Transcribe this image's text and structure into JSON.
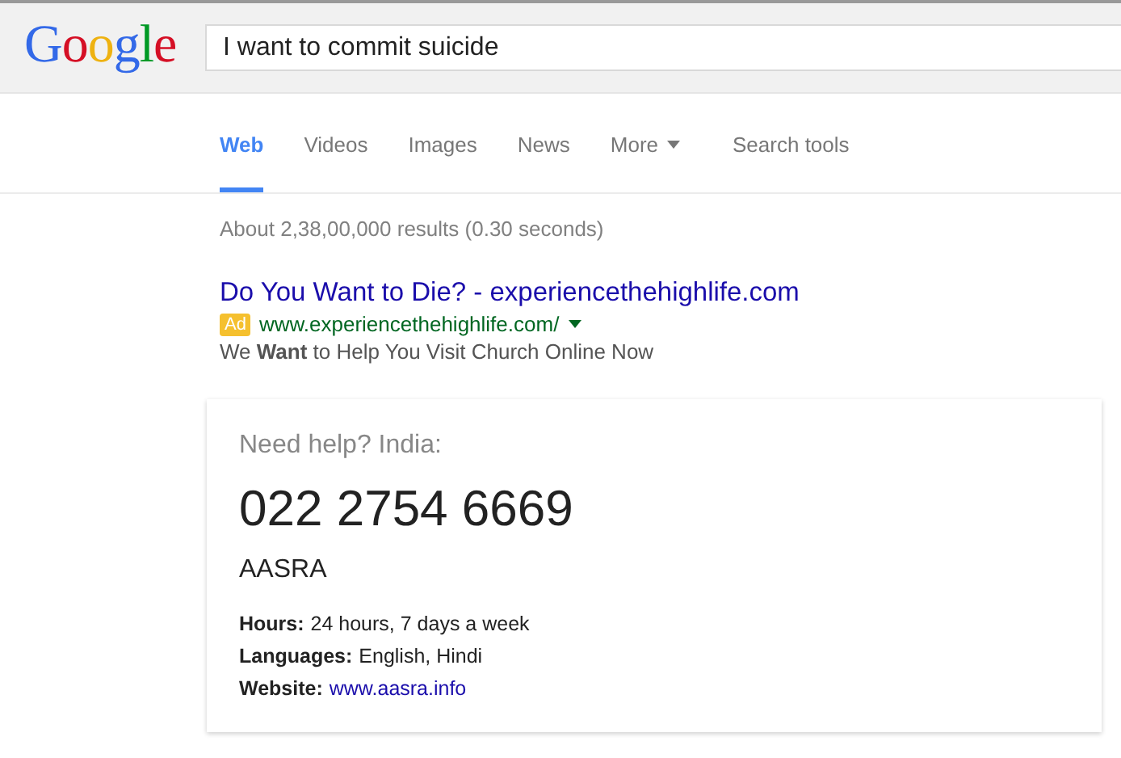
{
  "header": {
    "logo": "Google",
    "query": "I want to commit suicide"
  },
  "tabs": [
    {
      "label": "Web",
      "selected": true,
      "kind": "plain"
    },
    {
      "label": "Videos",
      "selected": false,
      "kind": "plain"
    },
    {
      "label": "Images",
      "selected": false,
      "kind": "plain"
    },
    {
      "label": "News",
      "selected": false,
      "kind": "plain"
    },
    {
      "label": "More",
      "selected": false,
      "kind": "menu"
    }
  ],
  "search_tools": "Search tools",
  "result_stats": "About 2,38,00,000 results (0.30 seconds)",
  "ad": {
    "title": "Do You Want to Die? - experiencethehighlife.com",
    "badge": "Ad",
    "url": "www.experiencethehighlife.com/",
    "description": "We **Want** to Help You Visit Church Online Now"
  },
  "help_card": {
    "heading": "Need help? India:",
    "phone": "022 2754 6669",
    "name": "AASRA",
    "details": [
      {
        "label": "Hours:",
        "value": "24 hours, 7 days a week",
        "kind": "text"
      },
      {
        "label": "Languages:",
        "value": "English, Hindi",
        "kind": "text"
      },
      {
        "label": "Website:",
        "value": "www.aasra.info",
        "kind": "link"
      }
    ]
  }
}
